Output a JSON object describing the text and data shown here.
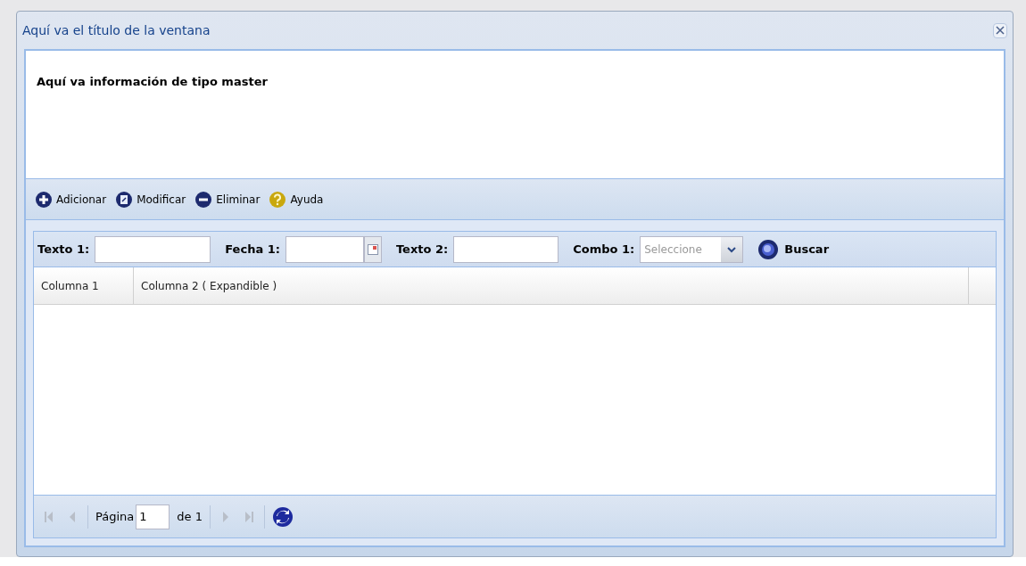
{
  "window": {
    "title": "Aquí va el título de la ventana"
  },
  "master": {
    "text": "Aquí va información de tipo master"
  },
  "toolbar": [
    {
      "kind": "add",
      "label": "Adicionar"
    },
    {
      "kind": "edit",
      "label": "Modificar"
    },
    {
      "kind": "delete",
      "label": "Eliminar"
    },
    {
      "kind": "help",
      "label": "Ayuda"
    }
  ],
  "filters": [
    {
      "kind": "text",
      "label": "Texto 1:"
    },
    {
      "kind": "date",
      "label": "Fecha 1:"
    },
    {
      "kind": "text",
      "label": "Texto 2:"
    },
    {
      "kind": "combo",
      "label": "Combo 1:",
      "placeholder": "Seleccione"
    }
  ],
  "search_button": "Buscar",
  "table": {
    "columns": [
      "Columna 1",
      "Columna 2 ( Expandible )"
    ]
  },
  "pager": {
    "first_disabled": true,
    "prev_disabled": true,
    "page_label": "Página",
    "page": "1",
    "of": "de 1",
    "next_disabled": true,
    "last_disabled": true
  }
}
